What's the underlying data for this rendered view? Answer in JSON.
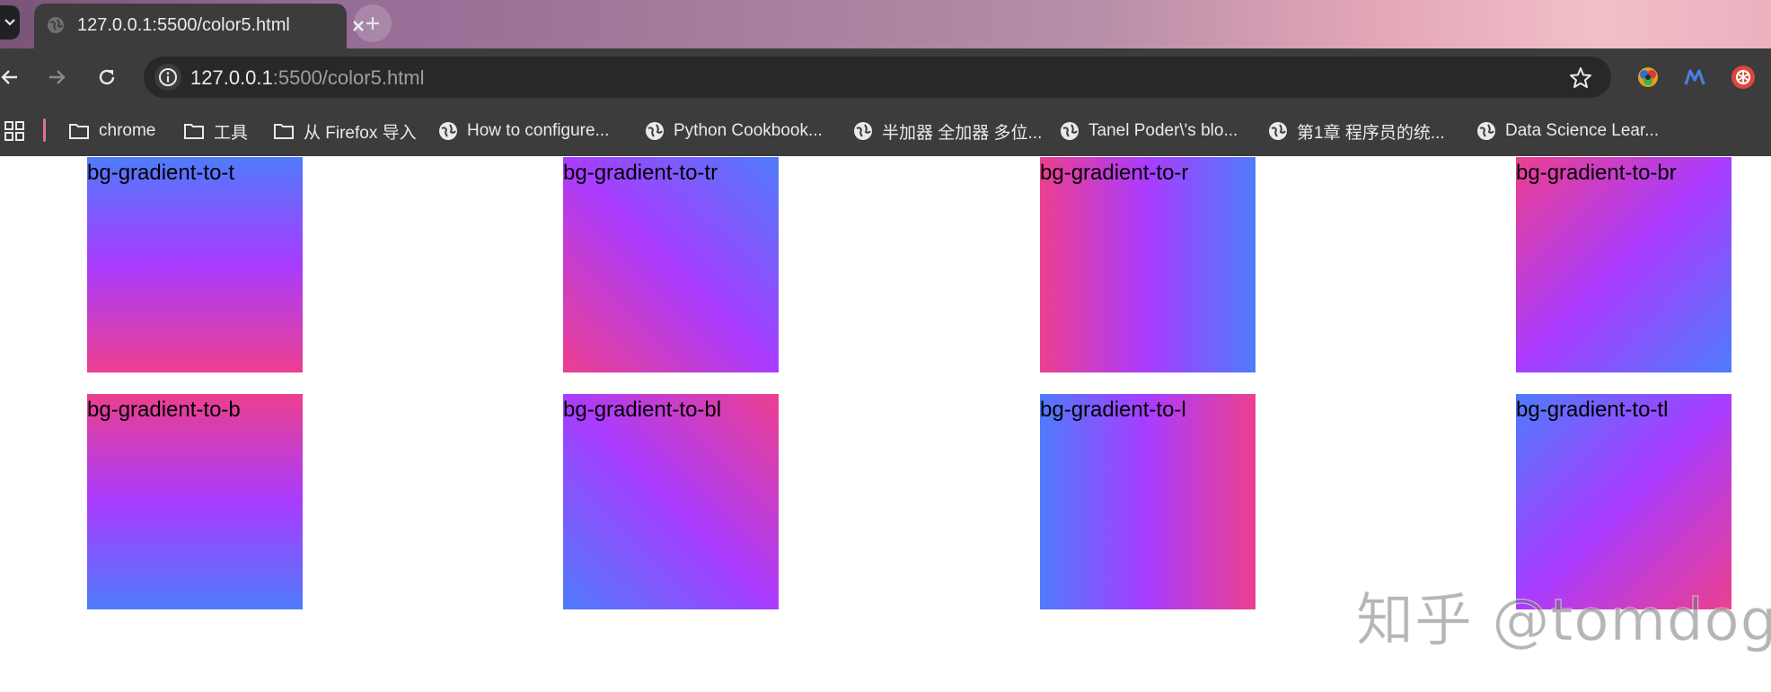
{
  "browser": {
    "tab_title": "127.0.0.1:5500/color5.html",
    "url_host": "127.0.0.1",
    "url_rest": ":5500/color5.html"
  },
  "bookmarks": [
    {
      "label": "chrome",
      "icon": "folder-icon"
    },
    {
      "label": "工具",
      "icon": "folder-icon"
    },
    {
      "label": "从 Firefox 导入",
      "icon": "folder-icon"
    },
    {
      "label": "How to configure...",
      "icon": "globe-icon"
    },
    {
      "label": "Python Cookbook...",
      "icon": "globe-icon"
    },
    {
      "label": "半加器 全加器 多位...",
      "icon": "globe-icon"
    },
    {
      "label": "Tanel Poder\\'s blo...",
      "icon": "globe-icon"
    },
    {
      "label": "第1章 程序员的统...",
      "icon": "globe-icon"
    },
    {
      "label": "Data Science Lear...",
      "icon": "globe-icon"
    }
  ],
  "colors": {
    "from": "#ec3f8f",
    "via": "#a93cff",
    "to": "#4f7bfb"
  },
  "boxes": [
    {
      "label": "bg-gradient-to-t",
      "direction": "to top"
    },
    {
      "label": "bg-gradient-to-tr",
      "direction": "to top right"
    },
    {
      "label": "bg-gradient-to-r",
      "direction": "to right"
    },
    {
      "label": "bg-gradient-to-br",
      "direction": "to bottom right"
    },
    {
      "label": "bg-gradient-to-b",
      "direction": "to bottom"
    },
    {
      "label": "bg-gradient-to-bl",
      "direction": "to bottom left"
    },
    {
      "label": "bg-gradient-to-l",
      "direction": "to left"
    },
    {
      "label": "bg-gradient-to-tl",
      "direction": "to top left"
    }
  ],
  "watermark": "知乎 @tomdog"
}
